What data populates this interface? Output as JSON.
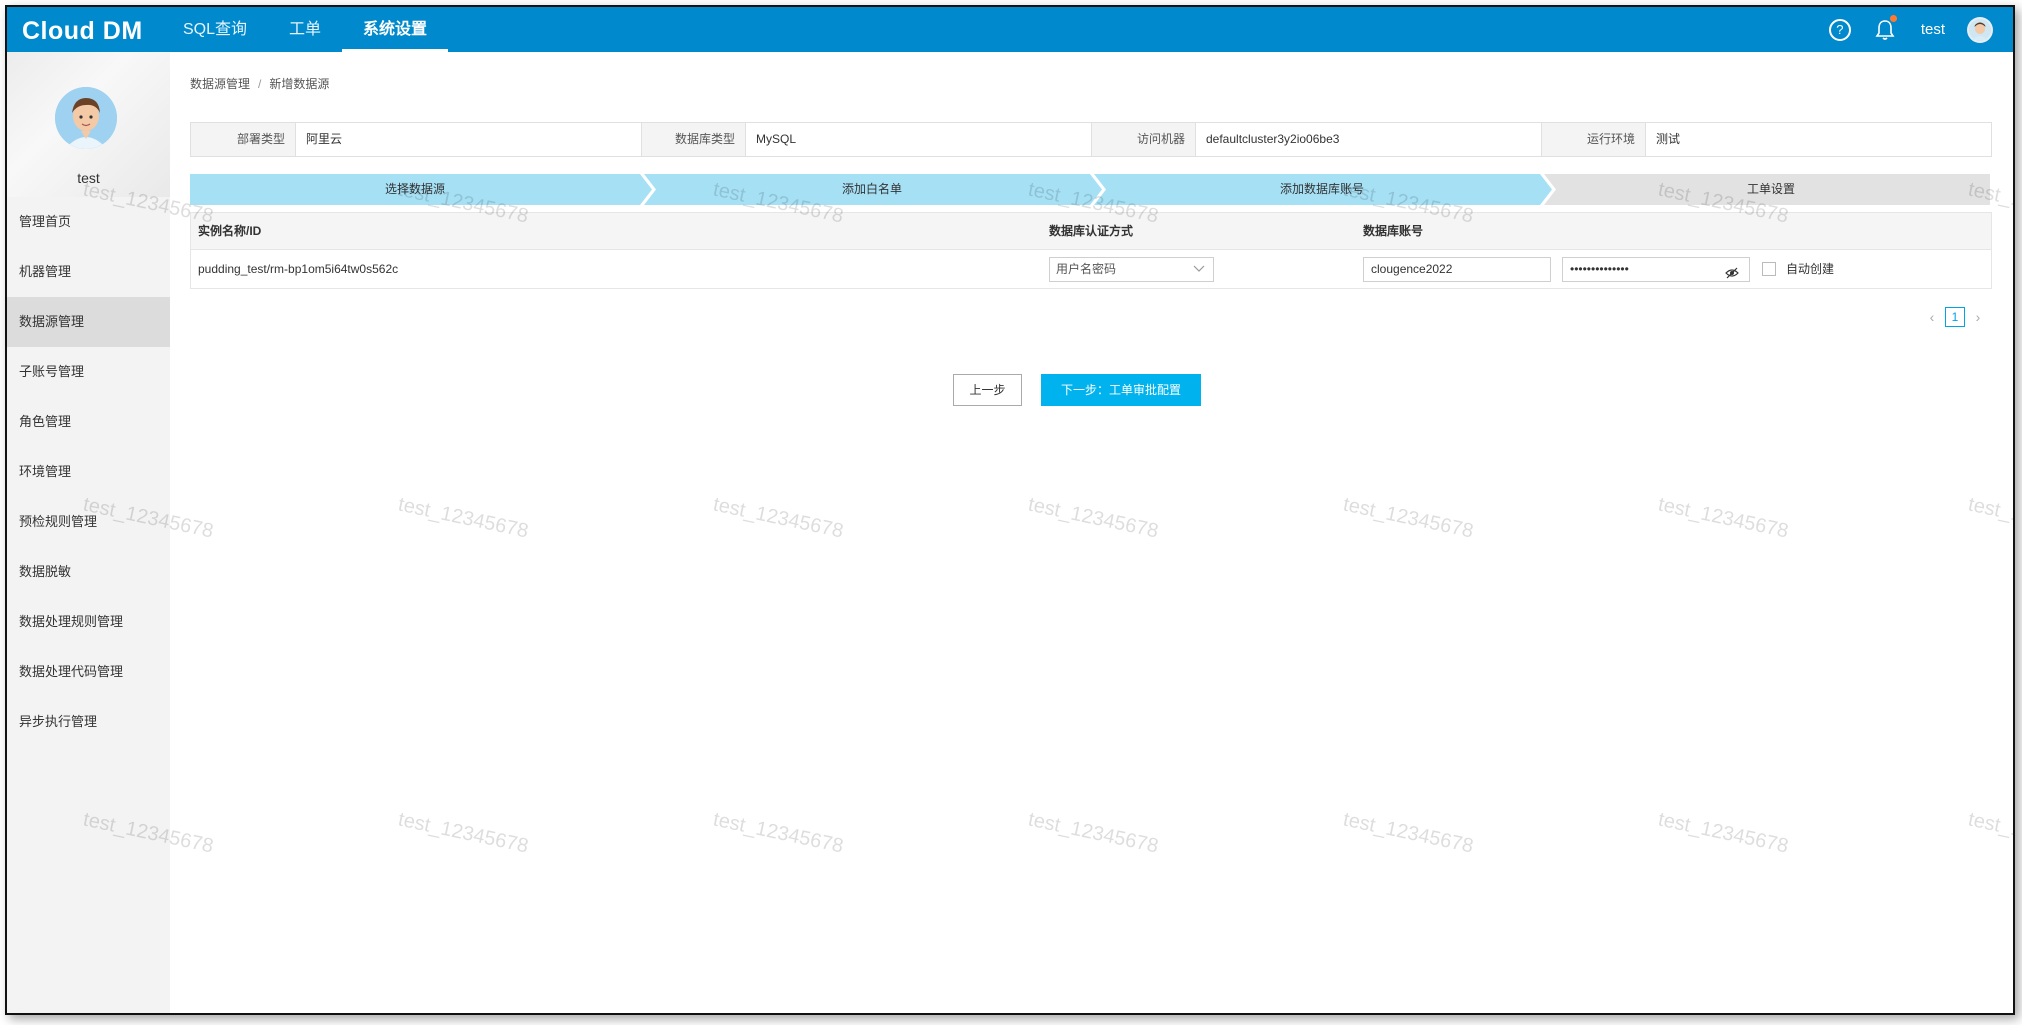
{
  "app": {
    "logo": "Cloud DM"
  },
  "topnav": {
    "items": [
      "SQL查询",
      "工单",
      "系统设置"
    ]
  },
  "user": {
    "name": "test"
  },
  "icons": {
    "help": "help-circle-icon",
    "bell": "bell-icon",
    "avatar": "avatar-icon",
    "eye": "eye-off-icon"
  },
  "colors": {
    "topbar": "#0089cc",
    "primary": "#00b3ee",
    "step_active": "#a6e0f5",
    "step_inactive": "#e2e2e2"
  },
  "sidebar": {
    "user": "test",
    "items": [
      {
        "label": "管理首页"
      },
      {
        "label": "机器管理"
      },
      {
        "label": "数据源管理"
      },
      {
        "label": "子账号管理"
      },
      {
        "label": "角色管理"
      },
      {
        "label": "环境管理"
      },
      {
        "label": "预检规则管理"
      },
      {
        "label": "数据脱敏"
      },
      {
        "label": "数据处理规则管理"
      },
      {
        "label": "数据处理代码管理"
      },
      {
        "label": "异步执行管理"
      }
    ]
  },
  "breadcrumb": {
    "parent": "数据源管理",
    "current": "新增数据源"
  },
  "info": [
    {
      "label": "部署类型",
      "value": "阿里云"
    },
    {
      "label": "数据库类型",
      "value": "MySQL"
    },
    {
      "label": "访问机器",
      "value": "defaultcluster3y2io06be3"
    },
    {
      "label": "运行环境",
      "value": "测试"
    }
  ],
  "steps": [
    "选择数据源",
    "添加白名单",
    "添加数据库账号",
    "工单设置"
  ],
  "table": {
    "headers": [
      "实例名称/ID",
      "数据库认证方式",
      "数据库账号"
    ],
    "row": {
      "instance": "pudding_test/rm-bp1om5i64tw0s562c",
      "auth": "用户名密码",
      "account": "clougence2022",
      "password": "••••••••••••••",
      "auto_create": "自动创建"
    }
  },
  "pagination": {
    "current": "1"
  },
  "buttons": {
    "prev": "上一步",
    "next": "下一步：工单审批配置"
  },
  "watermark": "test_12345678"
}
